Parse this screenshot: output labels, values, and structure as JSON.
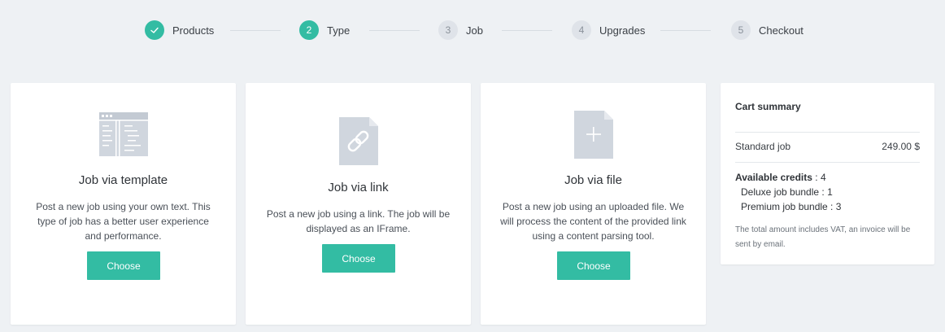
{
  "stepper": {
    "steps": [
      {
        "number": "",
        "label": "Products",
        "state": "done"
      },
      {
        "number": "2",
        "label": "Type",
        "state": "active"
      },
      {
        "number": "3",
        "label": "Job",
        "state": "pending"
      },
      {
        "number": "4",
        "label": "Upgrades",
        "state": "pending"
      },
      {
        "number": "5",
        "label": "Checkout",
        "state": "pending"
      }
    ]
  },
  "cards": [
    {
      "icon": "template-layout-icon",
      "title": "Job via template",
      "description": "Post a new job using your own text. This type of job has a better user experience and performance.",
      "button_label": "Choose"
    },
    {
      "icon": "file-link-icon",
      "title": "Job via link",
      "description": "Post a new job using a link. The job will be displayed as an IFrame.",
      "button_label": "Choose"
    },
    {
      "icon": "file-add-icon",
      "title": "Job via file",
      "description": "Post a new job using an uploaded file. We will process the content of the provided link using a content parsing tool.",
      "button_label": "Choose"
    }
  ],
  "cart": {
    "title": "Cart summary",
    "item_name": "Standard job",
    "item_price": "249.00 $",
    "credits_label": "Available credits",
    "credits_value": " : 4",
    "deluxe_label": "Deluxe job bundle : 1",
    "premium_label": "Premium job bundle : 3",
    "note": "The total amount includes VAT, an invoice will be sent by email."
  },
  "colors": {
    "accent": "#33bca3",
    "background": "#eef1f4",
    "icon_gray": "#d0d6de"
  }
}
